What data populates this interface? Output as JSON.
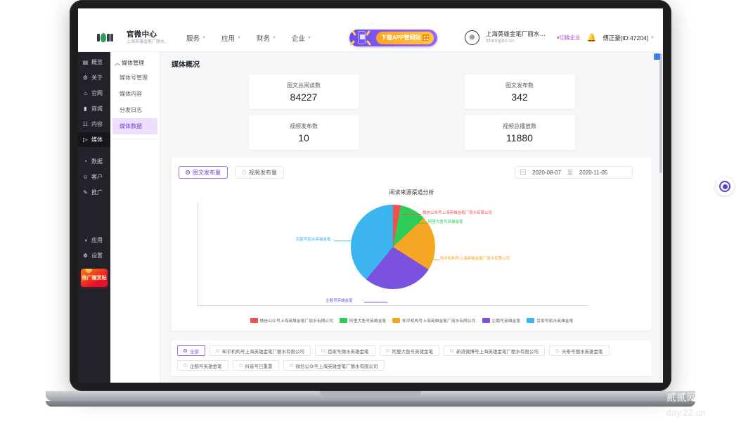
{
  "header": {
    "brand_title": "官微中心",
    "brand_sub": "上海英雄金笔厂丽水...",
    "nav": [
      {
        "label": "服务"
      },
      {
        "label": "应用"
      },
      {
        "label": "财务"
      },
      {
        "label": "企业"
      }
    ],
    "promo_label": "下载APP管网站",
    "org_name": "上海英雄金笔厂丽水有...",
    "org_domain": "lsheropen.cn",
    "switch_org": "切换企业",
    "user_label": "傅正豪[ID:47204]"
  },
  "sidebar": {
    "items": [
      {
        "icon": "monitor-icon",
        "glyph": "▤",
        "label": "概览",
        "active": false
      },
      {
        "icon": "gear-icon",
        "glyph": "⚙",
        "label": "关于",
        "active": false
      },
      {
        "icon": "home-icon",
        "glyph": "⌂",
        "label": "官网",
        "active": false
      },
      {
        "icon": "shop-icon",
        "glyph": "▬",
        "label": "商城",
        "active": false
      },
      {
        "icon": "doc-icon",
        "glyph": "☷",
        "label": "内容",
        "active": false
      },
      {
        "icon": "media-icon",
        "glyph": "▷",
        "label": "媒体",
        "active": true
      },
      {
        "icon": "data-icon",
        "glyph": "◴",
        "label": "数据",
        "active": false
      },
      {
        "icon": "customer-icon",
        "glyph": "☺",
        "label": "客户",
        "active": false
      },
      {
        "icon": "promo-icon",
        "glyph": "✒",
        "label": "推广",
        "active": false
      }
    ],
    "bottom_items": [
      {
        "icon": "apps-icon",
        "glyph": "◕",
        "label": "应用"
      },
      {
        "icon": "settings-icon",
        "glyph": "☸",
        "label": "设置"
      }
    ],
    "badge_label": "推广赚赏贴"
  },
  "subnav": {
    "group_label": "媒体管理",
    "items": [
      {
        "label": "媒体号管理",
        "active": false
      },
      {
        "label": "媒体内容",
        "active": false
      },
      {
        "label": "分发日志",
        "active": false
      },
      {
        "label": "媒体数据",
        "active": true
      }
    ]
  },
  "main": {
    "page_title": "媒体概况",
    "stats": [
      {
        "label": "图文总阅读数",
        "value": "84227"
      },
      {
        "label": "图文发布数",
        "value": "342"
      },
      {
        "label": "视频发布数",
        "value": "10"
      },
      {
        "label": "视频总播放数",
        "value": "11880"
      }
    ],
    "controls": {
      "radios": [
        {
          "label": "图文发布量",
          "active": true
        },
        {
          "label": "视频发布量",
          "active": false
        }
      ],
      "date_start": "2020-08-07",
      "date_sep": "至",
      "date_end": "2020-11-05"
    },
    "tag_filters": [
      {
        "label": "全部",
        "active": true
      },
      {
        "label": "知乎机构号上海英雄金笔厂丽水有限公司",
        "active": false
      },
      {
        "label": "百家号丽水英雄金笔",
        "active": false
      },
      {
        "label": "阿里大鱼号英雄金笔",
        "active": false
      },
      {
        "label": "新浪微博号上海英雄金笔厂丽水有限公司",
        "active": false
      },
      {
        "label": "头条号丽水英雄金笔",
        "active": false
      },
      {
        "label": "企鹅号英雄金笔",
        "active": false
      },
      {
        "label": "抖音号已重置",
        "active": false
      },
      {
        "label": "微信公众号上海英雄金笔厂丽水有限公司",
        "active": false
      }
    ]
  },
  "chart_data": {
    "type": "pie",
    "title": "阅读来源渠道分析",
    "xlabel": "",
    "ylabel": "",
    "legend_position": "bottom",
    "grid": false,
    "categories": [
      "微信公众号上海英雄金笔厂丽水有限公司",
      "阿里大鱼号英雄金笔",
      "知乎机构号上海英雄金笔厂丽水有限公司",
      "企鹅号英雄金笔",
      "百家号丽水英雄金笔"
    ],
    "values": [
      3,
      10,
      21,
      27,
      39
    ],
    "colors": [
      "#ef5350",
      "#2ecc58",
      "#f5a623",
      "#7b52e0",
      "#3bb4f0"
    ],
    "slices": [
      {
        "name": "微信公众号上海英雄金笔厂丽水有限公司",
        "value": 3,
        "color": "#ef5350"
      },
      {
        "name": "阿里大鱼号英雄金笔",
        "value": 10,
        "color": "#2ecc58"
      },
      {
        "name": "知乎机构号上海英雄金笔厂丽水有限公司",
        "value": 21,
        "color": "#f5a623"
      },
      {
        "name": "企鹅号英雄金笔",
        "value": 27,
        "color": "#7b52e0"
      },
      {
        "name": "百家号丽水英雄金笔",
        "value": 39,
        "color": "#3bb4f0"
      }
    ]
  },
  "watermark": {
    "line1": "贰贰网络(集团",
    "line2": "day.22.cn"
  }
}
